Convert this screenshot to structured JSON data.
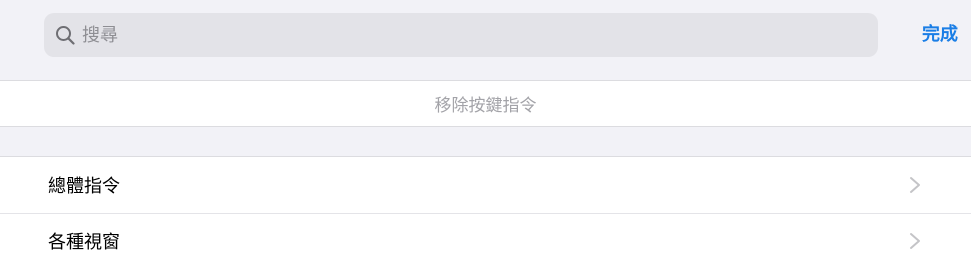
{
  "search": {
    "placeholder": "搜尋",
    "value": "",
    "icon": "search-icon"
  },
  "toolbar": {
    "done_label": "完成"
  },
  "remove_row": {
    "label": "移除按鍵指令"
  },
  "list": {
    "items": [
      {
        "label": "總體指令",
        "icon": "chevron-right-icon"
      },
      {
        "label": "各種視窗",
        "icon": "chevron-right-icon"
      }
    ]
  },
  "colors": {
    "accent": "#1a7ee6",
    "background": "#f2f2f7",
    "search_field": "#e3e3e8",
    "disabled_text": "#a3a3a8",
    "chevron": "#c4c4c7"
  }
}
